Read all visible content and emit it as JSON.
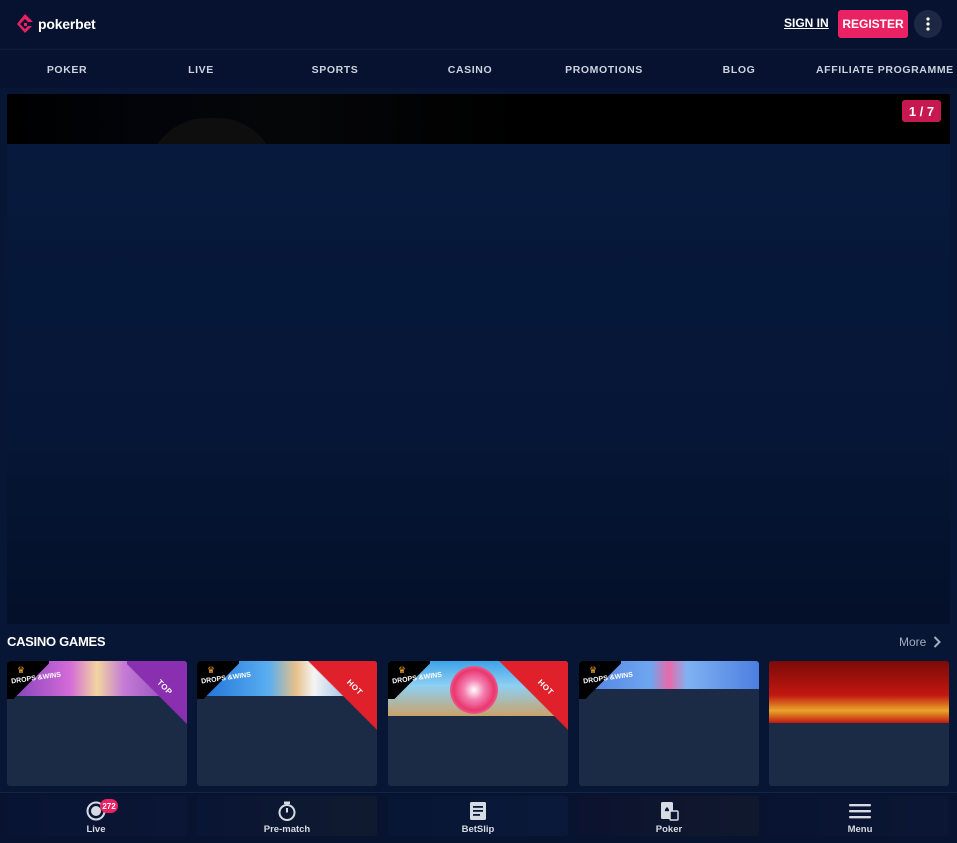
{
  "header": {
    "logo_text": "pokerbet",
    "sign_in": "SIGN IN",
    "register": "REGISTER"
  },
  "nav": [
    {
      "label": "POKER"
    },
    {
      "label": "LIVE"
    },
    {
      "label": "SPORTS"
    },
    {
      "label": "CASINO"
    },
    {
      "label": "PROMOTIONS"
    },
    {
      "label": "BLOG"
    },
    {
      "label": "AFFILIATE PROGRAMME"
    }
  ],
  "banner": {
    "counter": "1 / 7"
  },
  "casino": {
    "title": "CASINO GAMES",
    "more": "More",
    "games": [
      {
        "ribbon": "TOP",
        "ribbon_color": "#8a2fb0",
        "drops_wins": "DROPS &WINS"
      },
      {
        "ribbon": "HOT",
        "ribbon_color": "#e0202a",
        "drops_wins": "DROPS &WINS"
      },
      {
        "ribbon": "HOT",
        "ribbon_color": "#e0202a",
        "drops_wins": "DROPS &WINS"
      },
      {
        "ribbon": "",
        "ribbon_color": "",
        "drops_wins": "DROPS &WINS"
      },
      {
        "ribbon": "",
        "ribbon_color": "",
        "drops_wins": ""
      }
    ]
  },
  "tabbar": {
    "live_count": "272",
    "tabs": [
      {
        "label": "Live",
        "icon": "live-icon"
      },
      {
        "label": "Pre-match",
        "icon": "stopwatch-icon"
      },
      {
        "label": "BetSlip",
        "icon": "betslip-icon"
      },
      {
        "label": "Poker",
        "icon": "poker-card-icon"
      },
      {
        "label": "Menu",
        "icon": "menu-icon"
      }
    ]
  },
  "colors": {
    "background": "#071634",
    "header": "#061230",
    "accent": "#ea2163",
    "card": "#1b2a45"
  }
}
